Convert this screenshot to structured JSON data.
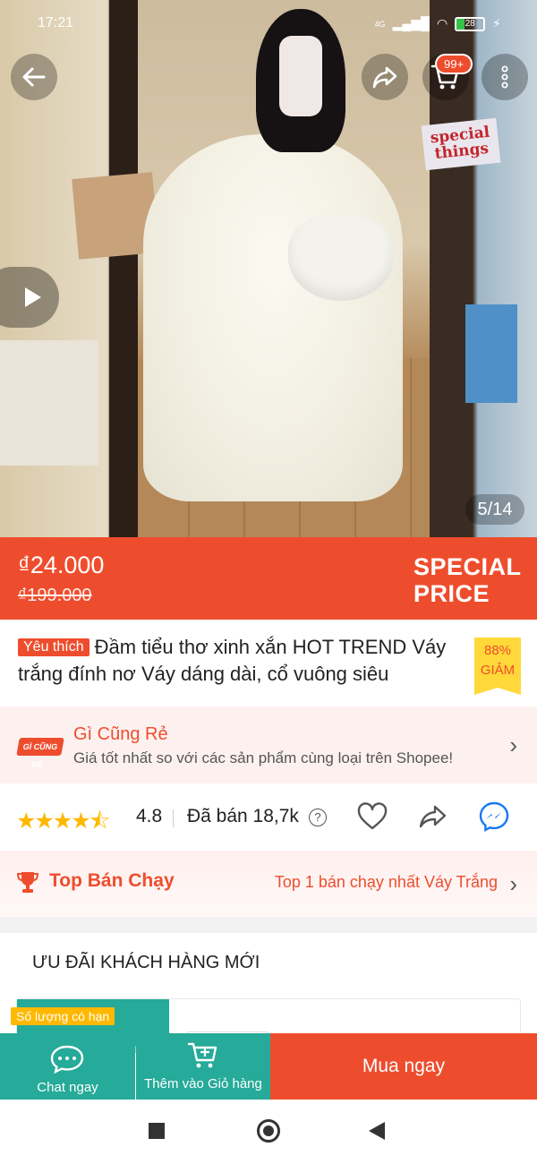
{
  "status_bar": {
    "time": "17:21",
    "network": "4G",
    "battery": "28"
  },
  "hero": {
    "cart_badge": "99+",
    "image_counter": "5/14",
    "sticker_line1": "special",
    "sticker_line2": "things"
  },
  "price": {
    "current": "₫24.000",
    "original": "₫199.000",
    "promo_line1": "SPECIAL",
    "promo_line2": "PRICE"
  },
  "product": {
    "favorite_tag": "Yêu thích",
    "title": "Đầm tiểu thơ xinh xắn HOT TREND Váy trắng đính nơ Váy dáng dài, cổ vuông siêu",
    "discount_percent": "88%",
    "discount_label": "GIẢM"
  },
  "cheap_banner": {
    "logo_text": "GÌ CŨNG RẺ",
    "title": "Gì Cũng Rẻ",
    "subtitle": "Giá tốt nhất so với các sản phẩm cùng loại trên Shopee!"
  },
  "rating": {
    "stars": "★★★★⯪",
    "value": "4.8",
    "sold": "Đã bán 18,7k",
    "help_icon": "?"
  },
  "top_seller": {
    "title": "Top Bán Chạy",
    "rank_text": "Top 1 bán chạy nhất Váy Trắng"
  },
  "offers": {
    "heading": "ƯU ĐÃI KHÁCH HÀNG MỚI",
    "limited_badge": "Số lượng có hạn"
  },
  "action_bar": {
    "chat_label": "Chat ngay",
    "add_cart_label": "Thêm vào Giỏ hàng",
    "buy_label": "Mua ngay"
  },
  "colors": {
    "brand": "#ee4d2d",
    "teal": "#26aa99",
    "star": "#ffb800",
    "discount_bg": "#ffd839"
  }
}
